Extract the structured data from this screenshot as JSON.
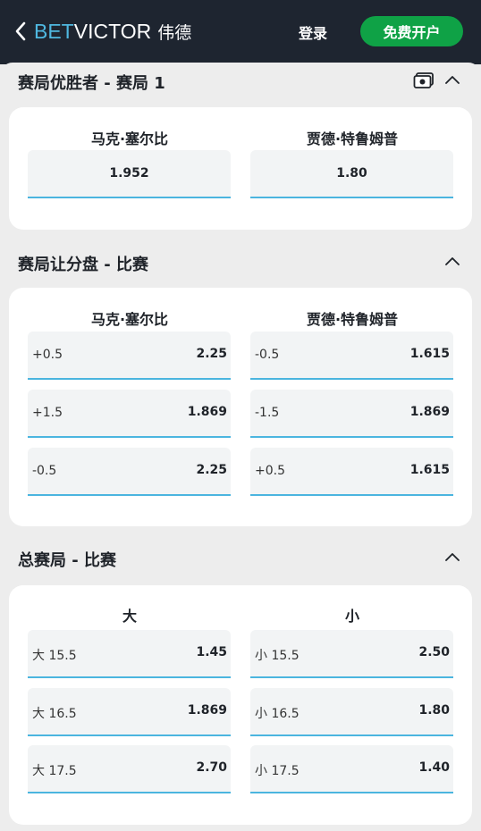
{
  "header": {
    "logo_bet": "BET",
    "logo_victor": "VICTOR",
    "logo_cn": "伟德",
    "login_label": "登录",
    "register_label": "免费开户"
  },
  "colors": {
    "brand_dark": "#1e2530",
    "accent_blue": "#4bb5df",
    "cta_green": "#0fa246"
  },
  "sections": [
    {
      "title": "赛局优胜者 - 赛局 1",
      "columns": [
        "马克·塞尔比",
        "贾德·特鲁姆普"
      ],
      "rows": [
        [
          {
            "label": "",
            "odds": "1.952"
          },
          {
            "label": "",
            "odds": "1.80"
          }
        ]
      ]
    },
    {
      "title": "赛局让分盘 - 比赛",
      "columns": [
        "马克·塞尔比",
        "贾德·特鲁姆普"
      ],
      "rows": [
        [
          {
            "label": "+0.5",
            "odds": "2.25"
          },
          {
            "label": "-0.5",
            "odds": "1.615"
          }
        ],
        [
          {
            "label": "+1.5",
            "odds": "1.869"
          },
          {
            "label": "-1.5",
            "odds": "1.869"
          }
        ],
        [
          {
            "label": "-0.5",
            "odds": "2.25"
          },
          {
            "label": "+0.5",
            "odds": "1.615"
          }
        ]
      ]
    },
    {
      "title": "总赛局 - 比赛",
      "columns": [
        "大",
        "小"
      ],
      "rows": [
        [
          {
            "label": "大 15.5",
            "odds": "1.45"
          },
          {
            "label": "小 15.5",
            "odds": "2.50"
          }
        ],
        [
          {
            "label": "大 16.5",
            "odds": "1.869"
          },
          {
            "label": "小 16.5",
            "odds": "1.80"
          }
        ],
        [
          {
            "label": "大 17.5",
            "odds": "2.70"
          },
          {
            "label": "小 17.5",
            "odds": "1.40"
          }
        ]
      ]
    }
  ]
}
